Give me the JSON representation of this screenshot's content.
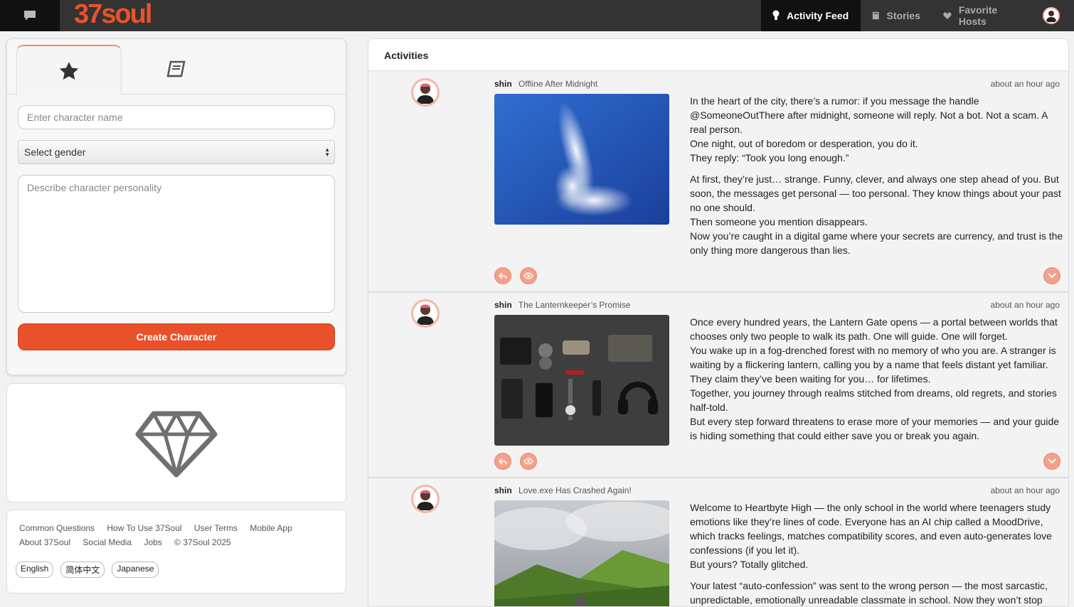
{
  "brand": {
    "logo_text": "37soul",
    "accent": "#e8532a"
  },
  "nav": {
    "items": [
      {
        "label": "Activity Feed",
        "icon": "lightbulb-icon",
        "active": true
      },
      {
        "label": "Stories",
        "icon": "book-icon",
        "active": false
      },
      {
        "label": "Favorite Hosts",
        "icon": "heart-icon",
        "active": false
      }
    ]
  },
  "create": {
    "name_placeholder": "Enter character name",
    "gender_label": "Select gender",
    "personality_placeholder": "Describe character personality",
    "button_label": "Create Character"
  },
  "footer": {
    "links": [
      "Common Questions",
      "How To Use 37Soul",
      "User Terms",
      "Mobile App",
      "About 37Soul",
      "Social Media",
      "Jobs",
      "© 37Soul 2025"
    ],
    "languages": [
      "English",
      "简体中文",
      "Japanese"
    ]
  },
  "feed": {
    "title": "Activities",
    "posts": [
      {
        "author": "shin",
        "story_title": "Offline After Midnight",
        "time": "about an hour ago",
        "paragraphs": [
          [
            "In the heart of the city, there’s a rumor: if you message the handle @SomeoneOutThere after midnight, someone will reply. Not a bot. Not a scam. A real person.",
            "One night, out of boredom or desperation, you do it.",
            "They reply: “Took you long enough.”"
          ],
          [
            "At first, they’re just… strange. Funny, clever, and always one step ahead of you. But soon, the messages get personal — too personal. They know things about your past no one should.",
            "Then someone you mention disappears.",
            "Now you’re caught in a digital game where your secrets are currency, and trust is the only thing more dangerous than lies."
          ]
        ]
      },
      {
        "author": "shin",
        "story_title": "The Lanternkeeper’s Promise",
        "time": "about an hour ago",
        "paragraphs": [
          [
            "Once every hundred years, the Lantern Gate opens — a portal between worlds that chooses only two people to walk its path. One will guide. One will forget.",
            "You wake up in a fog-drenched forest with no memory of who you are. A stranger is waiting by a flickering lantern, calling you by a name that feels distant yet familiar. They claim they’ve been waiting for you… for lifetimes.",
            "Together, you journey through realms stitched from dreams, old regrets, and stories half-told.",
            "But every step forward threatens to erase more of your memories — and your guide is hiding something that could either save you or break you again."
          ]
        ]
      },
      {
        "author": "shin",
        "story_title": "Love.exe Has Crashed Again!",
        "time": "about an hour ago",
        "paragraphs": [
          [
            "Welcome to Heartbyte High — the only school in the world where teenagers study emotions like they’re lines of code. Everyone has an AI chip called a MoodDrive, which tracks feelings, matches compatibility scores, and even auto-generates love confessions (if you let it).",
            "But yours? Totally glitched."
          ],
          [
            "Your latest “auto-confession” was sent to the wrong person — the most sarcastic, unpredictable, emotionally unreadable classmate in school. Now they won’t stop"
          ]
        ]
      }
    ]
  }
}
